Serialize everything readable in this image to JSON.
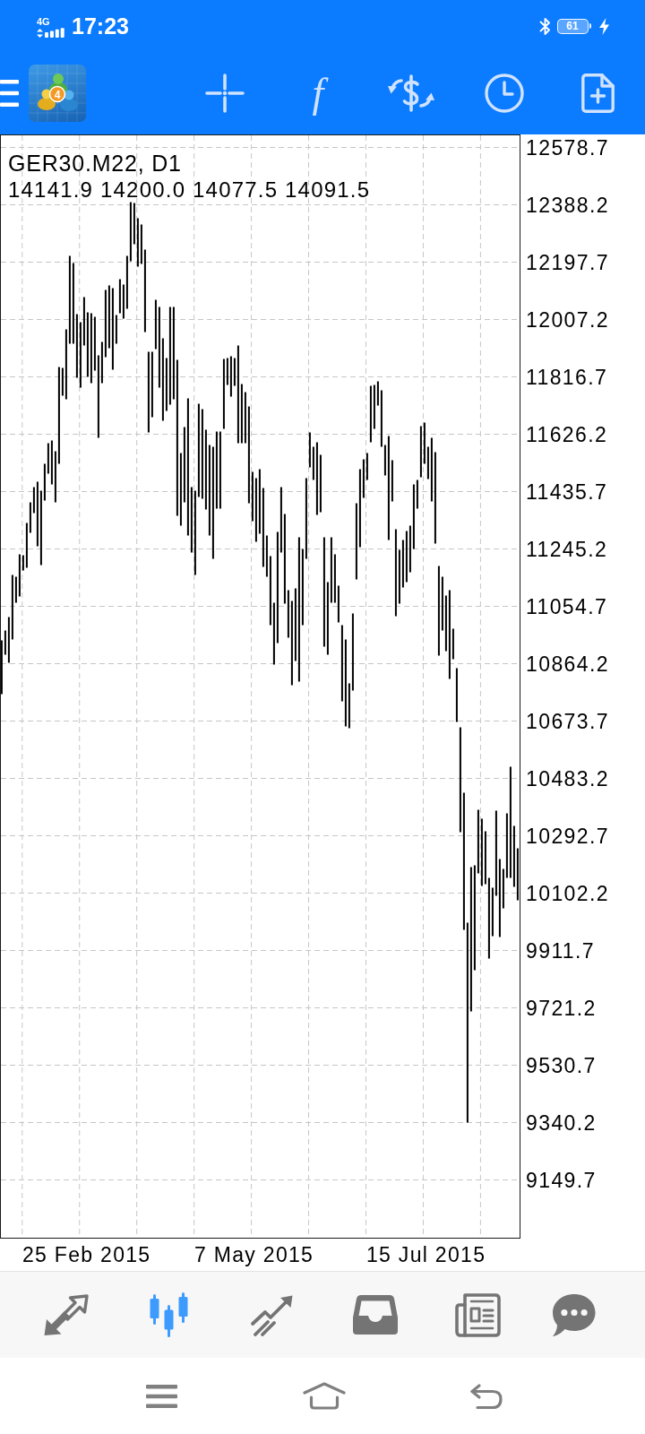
{
  "status_bar": {
    "network": "4G",
    "time": "17:23",
    "battery": "61"
  },
  "toolbar": {
    "logo_text": "4",
    "indicator_label": "f"
  },
  "chart": {
    "symbol": "GER30.M22, D1",
    "ohlc": "14141.9 14200.0 14077.5 14091.5",
    "price_labels": [
      "12578.7",
      "12388.2",
      "12197.7",
      "12007.2",
      "11816.7",
      "11626.2",
      "11435.7",
      "11245.2",
      "11054.7",
      "10864.2",
      "10673.7",
      "10483.2",
      "10292.7",
      "10102.2",
      "9911.7",
      "9721.2",
      "9530.7",
      "9340.2",
      "9149.7"
    ],
    "date_labels": [
      "25 Feb 2015",
      "7 May 2015",
      "15 Jul 2015"
    ]
  },
  "tabs": [
    {
      "selected": false
    },
    {
      "selected": true
    },
    {
      "selected": false
    },
    {
      "selected": false
    },
    {
      "selected": false
    },
    {
      "selected": false
    }
  ]
}
